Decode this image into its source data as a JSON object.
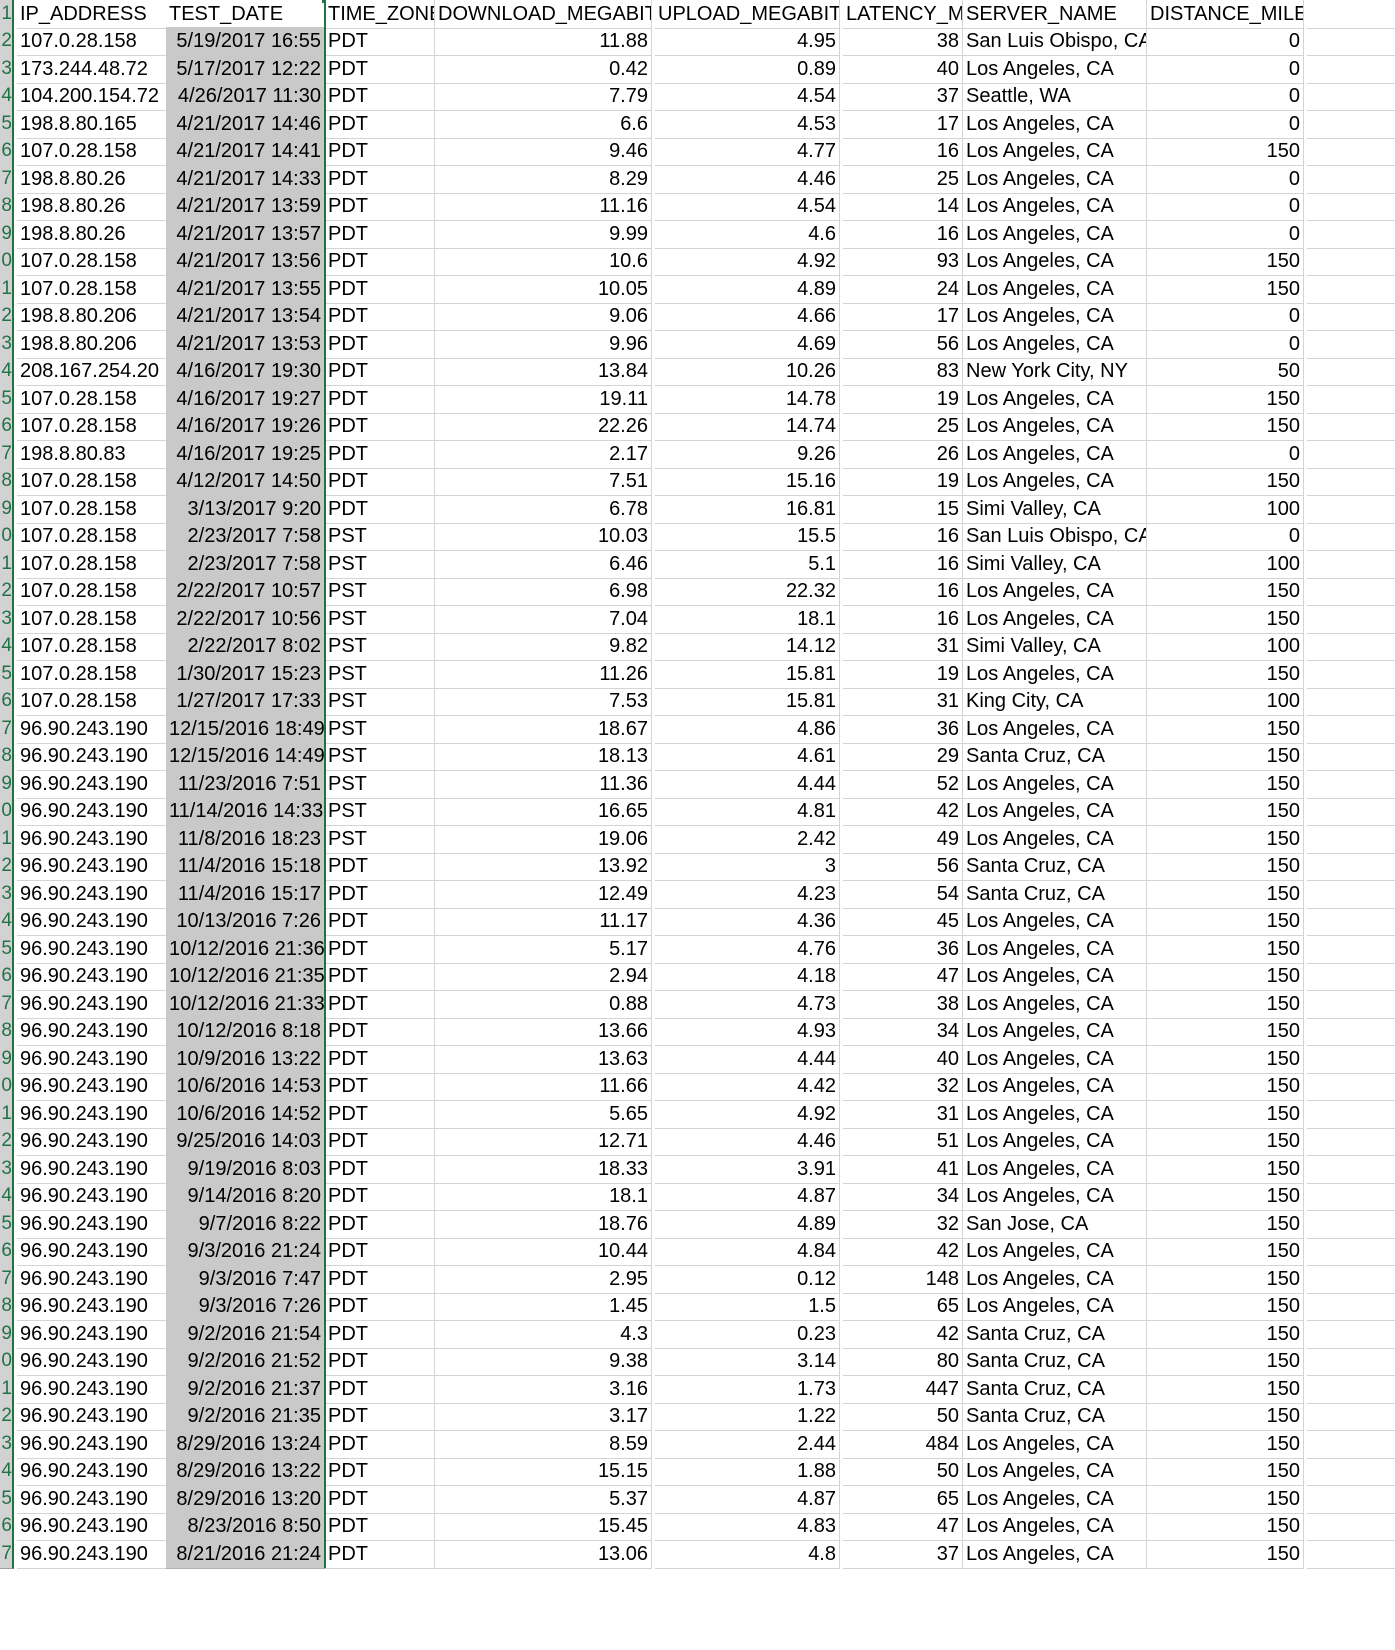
{
  "spreadsheet": {
    "accent_color": "#217346",
    "selected_column": "TEST_DATE",
    "columns": [
      "IP_ADDRESS",
      "TEST_DATE",
      "TIME_ZONE",
      "DOWNLOAD_MEGABITS",
      "UPLOAD_MEGABITS",
      "LATENCY_MS",
      "SERVER_NAME",
      "DISTANCE_MILES"
    ],
    "row_number_labels": [
      "1",
      "2",
      "3",
      "4",
      "5",
      "6",
      "7",
      "8",
      "9",
      "0",
      "1",
      "2",
      "3",
      "4",
      "5",
      "6",
      "7",
      "8",
      "9",
      "0",
      "1",
      "2",
      "3",
      "4",
      "5",
      "6",
      "7",
      "8",
      "9",
      "0",
      "1",
      "2",
      "3",
      "4",
      "5",
      "6",
      "7",
      "8",
      "9",
      "0",
      "1",
      "2",
      "3",
      "4",
      "5",
      "6",
      "7",
      "8",
      "9",
      "0",
      "1",
      "2",
      "3",
      "4",
      "5",
      "6",
      "7"
    ],
    "rows": [
      [
        "107.0.28.158",
        "5/19/2017 16:55",
        "PDT",
        "11.88",
        "4.95",
        "38",
        "San Luis Obispo, CA",
        "0"
      ],
      [
        "173.244.48.72",
        "5/17/2017 12:22",
        "PDT",
        "0.42",
        "0.89",
        "40",
        "Los Angeles, CA",
        "0"
      ],
      [
        "104.200.154.72",
        "4/26/2017 11:30",
        "PDT",
        "7.79",
        "4.54",
        "37",
        "Seattle, WA",
        "0"
      ],
      [
        "198.8.80.165",
        "4/21/2017 14:46",
        "PDT",
        "6.6",
        "4.53",
        "17",
        "Los Angeles, CA",
        "0"
      ],
      [
        "107.0.28.158",
        "4/21/2017 14:41",
        "PDT",
        "9.46",
        "4.77",
        "16",
        "Los Angeles, CA",
        "150"
      ],
      [
        "198.8.80.26",
        "4/21/2017 14:33",
        "PDT",
        "8.29",
        "4.46",
        "25",
        "Los Angeles, CA",
        "0"
      ],
      [
        "198.8.80.26",
        "4/21/2017 13:59",
        "PDT",
        "11.16",
        "4.54",
        "14",
        "Los Angeles, CA",
        "0"
      ],
      [
        "198.8.80.26",
        "4/21/2017 13:57",
        "PDT",
        "9.99",
        "4.6",
        "16",
        "Los Angeles, CA",
        "0"
      ],
      [
        "107.0.28.158",
        "4/21/2017 13:56",
        "PDT",
        "10.6",
        "4.92",
        "93",
        "Los Angeles, CA",
        "150"
      ],
      [
        "107.0.28.158",
        "4/21/2017 13:55",
        "PDT",
        "10.05",
        "4.89",
        "24",
        "Los Angeles, CA",
        "150"
      ],
      [
        "198.8.80.206",
        "4/21/2017 13:54",
        "PDT",
        "9.06",
        "4.66",
        "17",
        "Los Angeles, CA",
        "0"
      ],
      [
        "198.8.80.206",
        "4/21/2017 13:53",
        "PDT",
        "9.96",
        "4.69",
        "56",
        "Los Angeles, CA",
        "0"
      ],
      [
        "208.167.254.20",
        "4/16/2017 19:30",
        "PDT",
        "13.84",
        "10.26",
        "83",
        "New York City, NY",
        "50"
      ],
      [
        "107.0.28.158",
        "4/16/2017 19:27",
        "PDT",
        "19.11",
        "14.78",
        "19",
        "Los Angeles, CA",
        "150"
      ],
      [
        "107.0.28.158",
        "4/16/2017 19:26",
        "PDT",
        "22.26",
        "14.74",
        "25",
        "Los Angeles, CA",
        "150"
      ],
      [
        "198.8.80.83",
        "4/16/2017 19:25",
        "PDT",
        "2.17",
        "9.26",
        "26",
        "Los Angeles, CA",
        "0"
      ],
      [
        "107.0.28.158",
        "4/12/2017 14:50",
        "PDT",
        "7.51",
        "15.16",
        "19",
        "Los Angeles, CA",
        "150"
      ],
      [
        "107.0.28.158",
        "3/13/2017 9:20",
        "PDT",
        "6.78",
        "16.81",
        "15",
        "Simi Valley, CA",
        "100"
      ],
      [
        "107.0.28.158",
        "2/23/2017 7:58",
        "PST",
        "10.03",
        "15.5",
        "16",
        "San Luis Obispo, CA",
        "0"
      ],
      [
        "107.0.28.158",
        "2/23/2017 7:58",
        "PST",
        "6.46",
        "5.1",
        "16",
        "Simi Valley, CA",
        "100"
      ],
      [
        "107.0.28.158",
        "2/22/2017 10:57",
        "PST",
        "6.98",
        "22.32",
        "16",
        "Los Angeles, CA",
        "150"
      ],
      [
        "107.0.28.158",
        "2/22/2017 10:56",
        "PST",
        "7.04",
        "18.1",
        "16",
        "Los Angeles, CA",
        "150"
      ],
      [
        "107.0.28.158",
        "2/22/2017 8:02",
        "PST",
        "9.82",
        "14.12",
        "31",
        "Simi Valley, CA",
        "100"
      ],
      [
        "107.0.28.158",
        "1/30/2017 15:23",
        "PST",
        "11.26",
        "15.81",
        "19",
        "Los Angeles, CA",
        "150"
      ],
      [
        "107.0.28.158",
        "1/27/2017 17:33",
        "PST",
        "7.53",
        "15.81",
        "31",
        "King City, CA",
        "100"
      ],
      [
        "96.90.243.190",
        "12/15/2016 18:49",
        "PST",
        "18.67",
        "4.86",
        "36",
        "Los Angeles, CA",
        "150"
      ],
      [
        "96.90.243.190",
        "12/15/2016 14:49",
        "PST",
        "18.13",
        "4.61",
        "29",
        "Santa Cruz, CA",
        "150"
      ],
      [
        "96.90.243.190",
        "11/23/2016 7:51",
        "PST",
        "11.36",
        "4.44",
        "52",
        "Los Angeles, CA",
        "150"
      ],
      [
        "96.90.243.190",
        "11/14/2016 14:33",
        "PST",
        "16.65",
        "4.81",
        "42",
        "Los Angeles, CA",
        "150"
      ],
      [
        "96.90.243.190",
        "11/8/2016 18:23",
        "PST",
        "19.06",
        "2.42",
        "49",
        "Los Angeles, CA",
        "150"
      ],
      [
        "96.90.243.190",
        "11/4/2016 15:18",
        "PDT",
        "13.92",
        "3",
        "56",
        "Santa Cruz, CA",
        "150"
      ],
      [
        "96.90.243.190",
        "11/4/2016 15:17",
        "PDT",
        "12.49",
        "4.23",
        "54",
        "Santa Cruz, CA",
        "150"
      ],
      [
        "96.90.243.190",
        "10/13/2016 7:26",
        "PDT",
        "11.17",
        "4.36",
        "45",
        "Los Angeles, CA",
        "150"
      ],
      [
        "96.90.243.190",
        "10/12/2016 21:36",
        "PDT",
        "5.17",
        "4.76",
        "36",
        "Los Angeles, CA",
        "150"
      ],
      [
        "96.90.243.190",
        "10/12/2016 21:35",
        "PDT",
        "2.94",
        "4.18",
        "47",
        "Los Angeles, CA",
        "150"
      ],
      [
        "96.90.243.190",
        "10/12/2016 21:33",
        "PDT",
        "0.88",
        "4.73",
        "38",
        "Los Angeles, CA",
        "150"
      ],
      [
        "96.90.243.190",
        "10/12/2016 8:18",
        "PDT",
        "13.66",
        "4.93",
        "34",
        "Los Angeles, CA",
        "150"
      ],
      [
        "96.90.243.190",
        "10/9/2016 13:22",
        "PDT",
        "13.63",
        "4.44",
        "40",
        "Los Angeles, CA",
        "150"
      ],
      [
        "96.90.243.190",
        "10/6/2016 14:53",
        "PDT",
        "11.66",
        "4.42",
        "32",
        "Los Angeles, CA",
        "150"
      ],
      [
        "96.90.243.190",
        "10/6/2016 14:52",
        "PDT",
        "5.65",
        "4.92",
        "31",
        "Los Angeles, CA",
        "150"
      ],
      [
        "96.90.243.190",
        "9/25/2016 14:03",
        "PDT",
        "12.71",
        "4.46",
        "51",
        "Los Angeles, CA",
        "150"
      ],
      [
        "96.90.243.190",
        "9/19/2016 8:03",
        "PDT",
        "18.33",
        "3.91",
        "41",
        "Los Angeles, CA",
        "150"
      ],
      [
        "96.90.243.190",
        "9/14/2016 8:20",
        "PDT",
        "18.1",
        "4.87",
        "34",
        "Los Angeles, CA",
        "150"
      ],
      [
        "96.90.243.190",
        "9/7/2016 8:22",
        "PDT",
        "18.76",
        "4.89",
        "32",
        "San Jose, CA",
        "150"
      ],
      [
        "96.90.243.190",
        "9/3/2016 21:24",
        "PDT",
        "10.44",
        "4.84",
        "42",
        "Los Angeles, CA",
        "150"
      ],
      [
        "96.90.243.190",
        "9/3/2016 7:47",
        "PDT",
        "2.95",
        "0.12",
        "148",
        "Los Angeles, CA",
        "150"
      ],
      [
        "96.90.243.190",
        "9/3/2016 7:26",
        "PDT",
        "1.45",
        "1.5",
        "65",
        "Los Angeles, CA",
        "150"
      ],
      [
        "96.90.243.190",
        "9/2/2016 21:54",
        "PDT",
        "4.3",
        "0.23",
        "42",
        "Santa Cruz, CA",
        "150"
      ],
      [
        "96.90.243.190",
        "9/2/2016 21:52",
        "PDT",
        "9.38",
        "3.14",
        "80",
        "Santa Cruz, CA",
        "150"
      ],
      [
        "96.90.243.190",
        "9/2/2016 21:37",
        "PDT",
        "3.16",
        "1.73",
        "447",
        "Santa Cruz, CA",
        "150"
      ],
      [
        "96.90.243.190",
        "9/2/2016 21:35",
        "PDT",
        "3.17",
        "1.22",
        "50",
        "Santa Cruz, CA",
        "150"
      ],
      [
        "96.90.243.190",
        "8/29/2016 13:24",
        "PDT",
        "8.59",
        "2.44",
        "484",
        "Los Angeles, CA",
        "150"
      ],
      [
        "96.90.243.190",
        "8/29/2016 13:22",
        "PDT",
        "15.15",
        "1.88",
        "50",
        "Los Angeles, CA",
        "150"
      ],
      [
        "96.90.243.190",
        "8/29/2016 13:20",
        "PDT",
        "5.37",
        "4.87",
        "65",
        "Los Angeles, CA",
        "150"
      ],
      [
        "96.90.243.190",
        "8/23/2016 8:50",
        "PDT",
        "15.45",
        "4.83",
        "47",
        "Los Angeles, CA",
        "150"
      ],
      [
        "96.90.243.190",
        "8/21/2016 21:24",
        "PDT",
        "13.06",
        "4.8",
        "37",
        "Los Angeles, CA",
        "150"
      ]
    ]
  }
}
